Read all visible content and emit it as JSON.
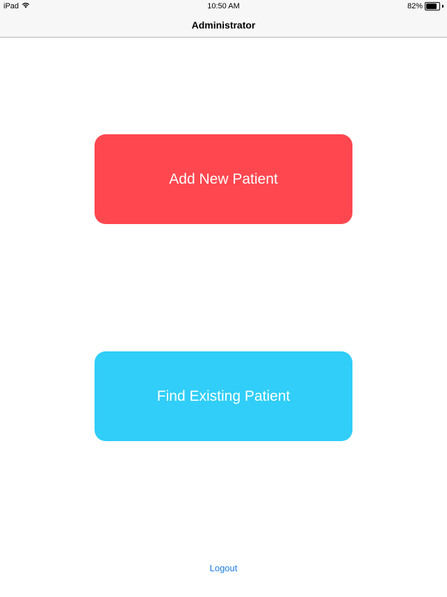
{
  "status_bar": {
    "device": "iPad",
    "wifi_icon": "wifi-icon",
    "time": "10:50 AM",
    "battery_percent": "82%",
    "battery_level": 0.82,
    "battery_icon": "battery-icon"
  },
  "nav": {
    "title": "Administrator"
  },
  "actions": {
    "add_label": "Add New Patient",
    "add_color": "#fe474f",
    "find_label": "Find Existing Patient",
    "find_color": "#30cef8"
  },
  "footer": {
    "logout_label": "Logout",
    "logout_color": "#1a7de2"
  }
}
